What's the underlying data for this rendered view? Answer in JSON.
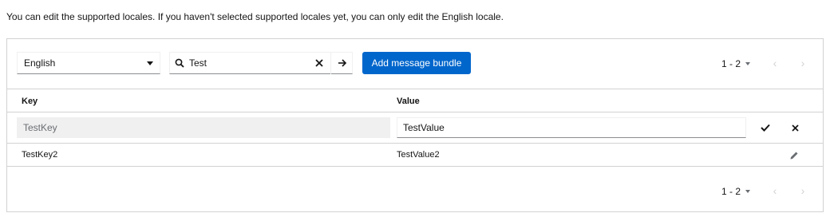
{
  "intro_text": "You can edit the supported locales. If you haven't selected supported locales yet, you can only edit the English locale.",
  "toolbar": {
    "locale_selected": "English",
    "search_value": "Test",
    "add_button_label": "Add message bundle"
  },
  "pagination": {
    "top_range": "1 - 2",
    "bottom_range": "1 - 2"
  },
  "table": {
    "columns": [
      "Key",
      "Value"
    ],
    "editing_row": {
      "key": "TestKey",
      "value": "TestValue"
    },
    "rows": [
      {
        "key": "TestKey2",
        "value": "TestValue2"
      }
    ]
  },
  "colors": {
    "primary": "#0066cc",
    "border": "#d2d2d2",
    "disabled_bg": "#f0f0f0"
  },
  "icons": [
    "caret-down-icon",
    "search-icon",
    "clear-icon",
    "arrow-right-icon",
    "angle-left-icon",
    "angle-right-icon",
    "check-icon",
    "times-icon",
    "pencil-icon"
  ]
}
